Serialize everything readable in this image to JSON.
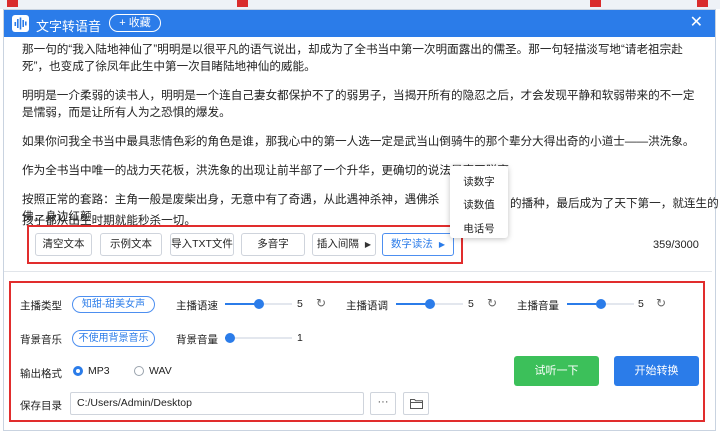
{
  "app": {
    "title": "文字转语音",
    "fav_label": "+ 收藏",
    "close_glyph": "✕"
  },
  "article": {
    "paragraphs": [
      "那一句的“我入陆地神仙了”明明是以很平凡的语气说出，却成为了全书当中第一次明面露出的儒圣。那一句轻描淡写地“请老祖宗赴死”，也变成了徐凤年此生中第一次目睹陆地神仙的威能。",
      "明明是一介柔弱的读书人，明明是一个连自己妻女都保护不了的弱男子，当揭开所有的隐忍之后，才会发现平静和软弱带来的不一定是懦弱，而是让所有人为之恐惧的爆发。",
      "如果你问我全书当中最具悲情色彩的角色是谁，那我心中的第一人选一定是武当山倒骑牛的那个辈分大得出奇的小道士——洪洗象。",
      "作为全书当中唯一的战力天花板，洪洗象的出现让前半部了一个升华，更确切的说法是真正脱离",
      "按照正常的套路：主角一般是废柴出身，无意中有了奇遇，从此遇神杀神，遇佛杀佛，身边红颜",
      "的播种，最后成为了天下第一，就连生的孩子都从出生时期就能秒杀一切。"
    ]
  },
  "toolbar": {
    "buttons": [
      "清空文本",
      "示例文本",
      "导入TXT文件",
      "多音字",
      "插入间隔",
      "数字读法"
    ],
    "counter": "359/3000"
  },
  "number_menu": {
    "items": [
      "读数字",
      "读数值",
      "电话号"
    ]
  },
  "settings": {
    "anchor_type_label": "主播类型",
    "anchor_type_value": "知甜-甜美女声",
    "speed_label": "主播语速",
    "speed_value": "5",
    "speed_level": 0.5,
    "pitch_label": "主播语调",
    "pitch_value": "5",
    "pitch_level": 0.5,
    "volume_label": "主播音量",
    "volume_value": "5",
    "volume_level": 0.5,
    "bgm_label": "背景音乐",
    "bgm_value": "不使用背景音乐",
    "bgm_volume_label": "背景音量",
    "bgm_volume_value": "1",
    "bgm_volume_level": 0.0,
    "format_label": "输出格式",
    "format_options": [
      "MP3",
      "WAV"
    ],
    "format_selected": "MP3",
    "listen_label": "试听一下",
    "convert_label": "开始转换",
    "save_dir_label": "保存目录",
    "save_dir_value": "C:/Users/Admin/Desktop",
    "browse_glyph": "···",
    "reset_glyph": "↻"
  },
  "colors": {
    "accent": "#2b7ce9",
    "green": "#3cc05a",
    "highlight_border": "#e12d2d"
  }
}
